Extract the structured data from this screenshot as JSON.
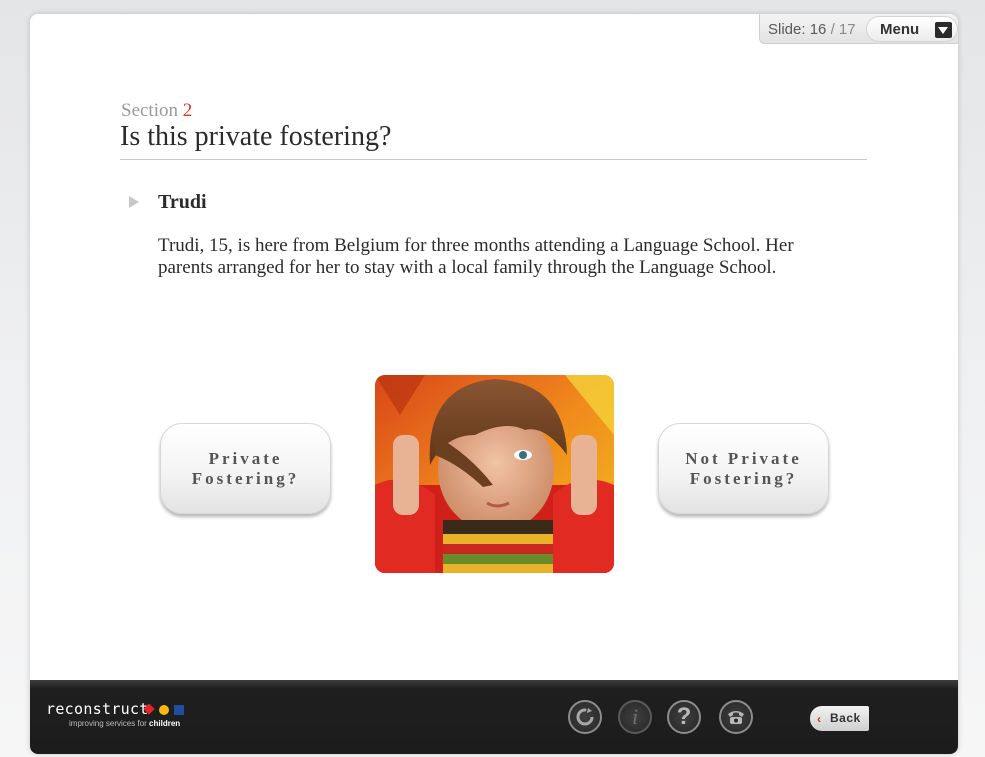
{
  "header": {
    "slide_label": "Slide:",
    "slide_current": "16",
    "slide_separator": "/",
    "slide_total": "17",
    "menu_label": "Menu"
  },
  "content": {
    "section_word": "Section",
    "section_number": "2",
    "title": "Is this private fostering?",
    "case_name": "Trudi",
    "case_text": "Trudi, 15, is here from Belgium for three months attending a Language School. Her parents arranged for her to stay with a local family through the Language School."
  },
  "choices": {
    "left": {
      "line1": "Private",
      "line2": "Fostering?"
    },
    "right": {
      "line1": "Not Private",
      "line2": "Fostering?"
    }
  },
  "footer": {
    "logo_text": "reconstruct",
    "tagline_prefix": "improving services for",
    "tagline_bold": "children",
    "back_label": "Back",
    "help_glyph": "?",
    "info_glyph": "i"
  },
  "icons": {
    "menu": "triangle-down-icon",
    "replay": "replay-icon",
    "info": "info-icon",
    "help": "help-icon",
    "contact": "telephone-icon",
    "back": "chevron-left-icon",
    "bullet": "triangle-right-icon"
  },
  "colors": {
    "section_number": "#e03a1e",
    "footer_bg": "#1c1c1c",
    "logo_red": "#e3222a",
    "logo_yellow": "#f7b912",
    "logo_blue": "#1f4fa3"
  }
}
